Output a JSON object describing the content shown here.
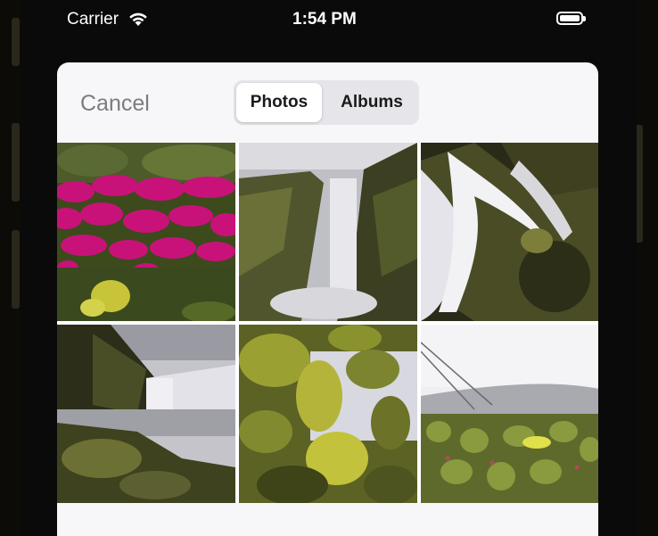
{
  "status_bar": {
    "carrier": "Carrier",
    "time": "1:54 PM"
  },
  "picker": {
    "cancel_label": "Cancel",
    "segments": [
      "Photos",
      "Albums"
    ],
    "selected_segment": "Photos"
  },
  "photos": [
    {
      "subject": "pink flowers"
    },
    {
      "subject": "waterfall"
    },
    {
      "subject": "waterfall close-up"
    },
    {
      "subject": "waterfall coast"
    },
    {
      "subject": "leaves"
    },
    {
      "subject": "meadow"
    }
  ]
}
